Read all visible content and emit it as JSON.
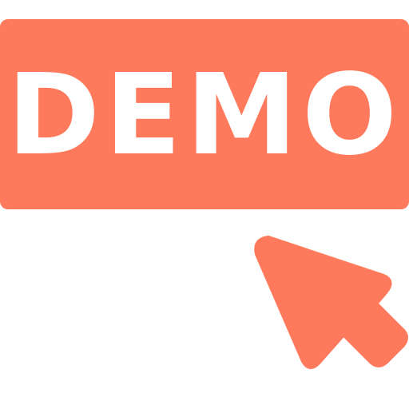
{
  "demo_button": {
    "label": "DEMO"
  },
  "icons": {
    "cursor": "arrow-cursor-icon"
  },
  "colors": {
    "accent": "#FF7A5C",
    "text": "#FFFFFF",
    "background": "#FFFFFF"
  }
}
